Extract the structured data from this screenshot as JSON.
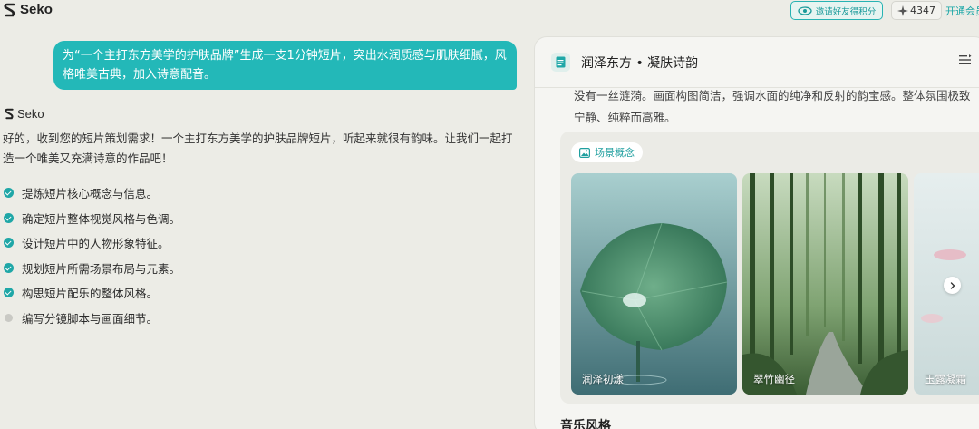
{
  "app": {
    "name": "Seko"
  },
  "topbar": {
    "invite_label": "邀请好友得积分",
    "credits": "4347",
    "vip_label": "开通会员"
  },
  "chat": {
    "user_message": "为“一个主打东方美学的护肤品牌”生成一支1分钟短片，突出水润质感与肌肤细腻，风格唯美古典，加入诗意配音。",
    "bot_name": "Seko",
    "bot_reply": "好的，收到您的短片策划需求！一个主打东方美学的护肤品牌短片，听起来就很有韵味。让我们一起打造一个唯美又充满诗意的作品吧！",
    "steps": [
      {
        "label": "提炼短片核心概念与信息。",
        "done": true
      },
      {
        "label": "确定短片整体视觉风格与色调。",
        "done": true
      },
      {
        "label": "设计短片中的人物形象特征。",
        "done": true
      },
      {
        "label": "规划短片所需场景布局与元素。",
        "done": true
      },
      {
        "label": "构思短片配乐的整体风格。",
        "done": true
      },
      {
        "label": "编写分镜脚本与画面细节。",
        "done": false
      }
    ]
  },
  "panel": {
    "title": "润泽东方 • 凝肤诗韵",
    "paragraph_partial": "没有一丝涟漪。画面构图简洁，强调水面的纯净和反射的韵宝感。整体氛围极致宁静、纯粹而高雅。",
    "scene_tag": "场景概念",
    "scenes": [
      {
        "label": "润泽初漾"
      },
      {
        "label": "翠竹幽径"
      },
      {
        "label": "玉露凝霜"
      }
    ],
    "music_title": "音乐风格"
  },
  "colors": {
    "accent": "#23b8b8",
    "background": "#ecece6"
  }
}
